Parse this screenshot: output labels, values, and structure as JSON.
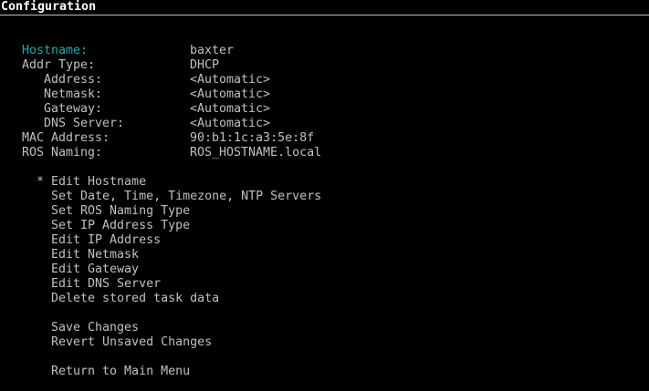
{
  "screen": {
    "title": "Configuration"
  },
  "colors": {
    "background": "#000000",
    "text": "#c0c0c0",
    "title": "#ffffff",
    "highlight": "#2aa6b3"
  },
  "fields": [
    {
      "label": "Hostname:",
      "value": "baxter"
    },
    {
      "label": "Addr Type:",
      "value": "DHCP"
    },
    {
      "label": "Address:",
      "value": "<Automatic>"
    },
    {
      "label": "Netmask:",
      "value": "<Automatic>"
    },
    {
      "label": "Gateway:",
      "value": "<Automatic>"
    },
    {
      "label": "DNS Server:",
      "value": "<Automatic>"
    },
    {
      "label": "MAC Address:",
      "value": "90:b1:1c:a3:5e:8f"
    },
    {
      "label": "ROS Naming:",
      "value": "ROS_HOSTNAME.local"
    }
  ],
  "menu": {
    "cursor": "*",
    "items": [
      "Edit Hostname",
      "Set Date, Time, Timezone, NTP Servers",
      "Set ROS Naming Type",
      "Set IP Address Type",
      "Edit IP Address",
      "Edit Netmask",
      "Edit Gateway",
      "Edit DNS Server",
      "Delete stored task data",
      "Save Changes",
      "Revert Unsaved Changes",
      "Return to Main Menu"
    ]
  }
}
